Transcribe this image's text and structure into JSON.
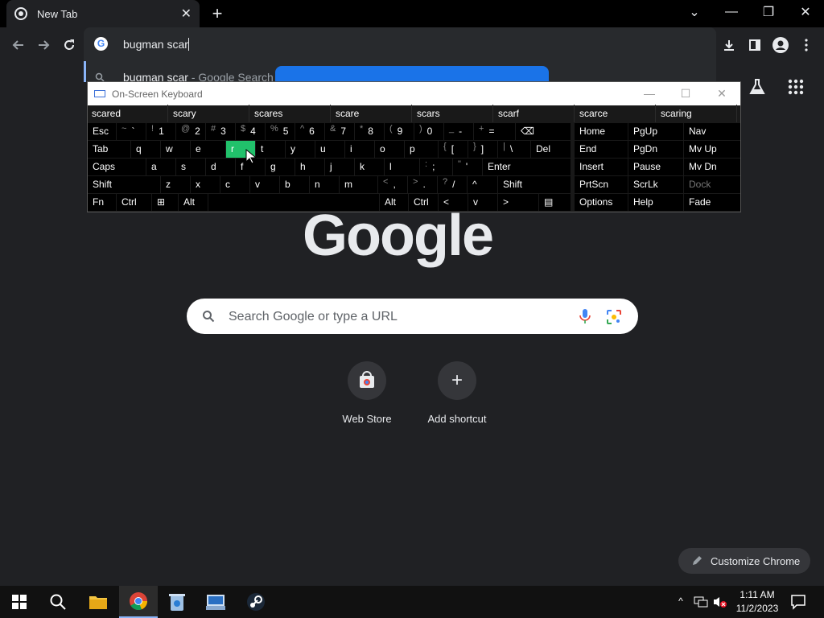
{
  "browser": {
    "tab_title": "New Tab",
    "tab_close": "✕",
    "new_tab": "+",
    "address_text": "bugman scar",
    "suggestion_query": "bugman scar",
    "suggestion_sep": " - ",
    "suggestion_suffix": "Google Search",
    "window_controls": {
      "minimize": "—",
      "restore": "❐",
      "close": "✕",
      "tabsearch": "⌄"
    }
  },
  "page": {
    "logo": "Google",
    "search_placeholder": "Search Google or type a URL",
    "shortcuts": [
      {
        "label": "Web Store"
      },
      {
        "label": "Add shortcut",
        "glyph": "+"
      }
    ],
    "customize_label": "Customize Chrome"
  },
  "osk": {
    "title": "On-Screen Keyboard",
    "predictions": [
      "scared",
      "scary",
      "scares",
      "scare",
      "scars",
      "scarf",
      "scarce",
      "scaring"
    ],
    "row1": [
      {
        "label": "Esc"
      },
      {
        "shift": "~",
        "label": "`"
      },
      {
        "shift": "!",
        "label": "1"
      },
      {
        "shift": "@",
        "label": "2"
      },
      {
        "shift": "#",
        "label": "3"
      },
      {
        "shift": "$",
        "label": "4"
      },
      {
        "shift": "%",
        "label": "5"
      },
      {
        "shift": "^",
        "label": "6"
      },
      {
        "shift": "&",
        "label": "7"
      },
      {
        "shift": "*",
        "label": "8"
      },
      {
        "shift": "(",
        "label": "9"
      },
      {
        "shift": ")",
        "label": "0"
      },
      {
        "shift": "_",
        "label": "-"
      },
      {
        "shift": "+",
        "label": "="
      },
      {
        "label": "⌫"
      }
    ],
    "row2": [
      {
        "label": "Tab"
      },
      {
        "label": "q"
      },
      {
        "label": "w"
      },
      {
        "label": "e"
      },
      {
        "label": "r",
        "highlight": true
      },
      {
        "label": "t"
      },
      {
        "label": "y"
      },
      {
        "label": "u"
      },
      {
        "label": "i"
      },
      {
        "label": "o"
      },
      {
        "label": "p"
      },
      {
        "shift": "{",
        "label": "["
      },
      {
        "shift": "}",
        "label": "]"
      },
      {
        "shift": "|",
        "label": "\\"
      },
      {
        "label": "Del"
      }
    ],
    "row3": [
      {
        "label": "Caps"
      },
      {
        "label": "a"
      },
      {
        "label": "s"
      },
      {
        "label": "d"
      },
      {
        "label": "f"
      },
      {
        "label": "g"
      },
      {
        "label": "h"
      },
      {
        "label": "j"
      },
      {
        "label": "k"
      },
      {
        "label": "l"
      },
      {
        "shift": ":",
        "label": ";"
      },
      {
        "shift": "\"",
        "label": "'"
      },
      {
        "label": "Enter"
      }
    ],
    "row4": [
      {
        "label": "Shift"
      },
      {
        "label": "z"
      },
      {
        "label": "x"
      },
      {
        "label": "c"
      },
      {
        "label": "v"
      },
      {
        "label": "b"
      },
      {
        "label": "n"
      },
      {
        "label": "m"
      },
      {
        "shift": "<",
        "label": ","
      },
      {
        "shift": ">",
        "label": "."
      },
      {
        "shift": "?",
        "label": "/"
      },
      {
        "label": "^"
      },
      {
        "label": "Shift"
      }
    ],
    "row5": [
      {
        "label": "Fn"
      },
      {
        "label": "Ctrl"
      },
      {
        "label": "⊞"
      },
      {
        "label": "Alt"
      },
      {
        "label": ""
      },
      {
        "label": "Alt"
      },
      {
        "label": "Ctrl"
      },
      {
        "label": "<"
      },
      {
        "label": "v"
      },
      {
        "label": ">"
      },
      {
        "label": "▤"
      }
    ],
    "side_rows": [
      [
        "Home",
        "PgUp",
        "Nav"
      ],
      [
        "End",
        "PgDn",
        "Mv Up"
      ],
      [
        "Insert",
        "Pause",
        "Mv Dn"
      ],
      [
        "PrtScn",
        "ScrLk",
        "Dock"
      ],
      [
        "Options",
        "Help",
        "Fade"
      ]
    ]
  },
  "taskbar": {
    "time": "1:11 AM",
    "date": "11/2/2023"
  }
}
